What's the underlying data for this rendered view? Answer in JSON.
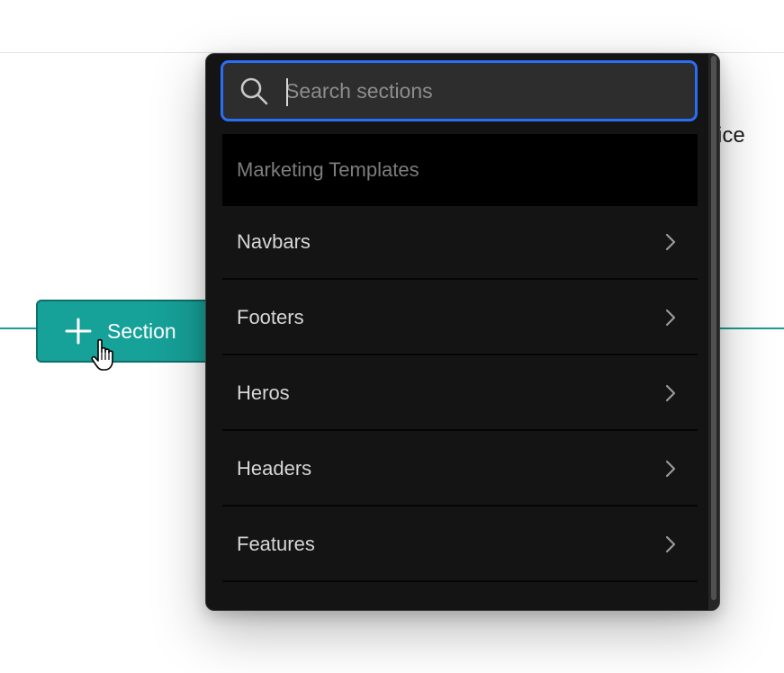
{
  "background": {
    "partial_text": "ice",
    "accent_line_color": "#1f9a94"
  },
  "add_section_button": {
    "label": "Section",
    "icon": "plus-icon",
    "color": "#16a199"
  },
  "cursor": {
    "icon": "hand-pointer-icon"
  },
  "dropdown": {
    "search": {
      "placeholder": "Search sections",
      "value": "",
      "icon": "search-icon",
      "focus_color": "#2a6ef5"
    },
    "group_label": "Marketing Templates",
    "items": [
      {
        "label": "Navbars",
        "icon": "chevron-right-icon"
      },
      {
        "label": "Footers",
        "icon": "chevron-right-icon"
      },
      {
        "label": "Heros",
        "icon": "chevron-right-icon"
      },
      {
        "label": "Headers",
        "icon": "chevron-right-icon"
      },
      {
        "label": "Features",
        "icon": "chevron-right-icon"
      }
    ]
  }
}
